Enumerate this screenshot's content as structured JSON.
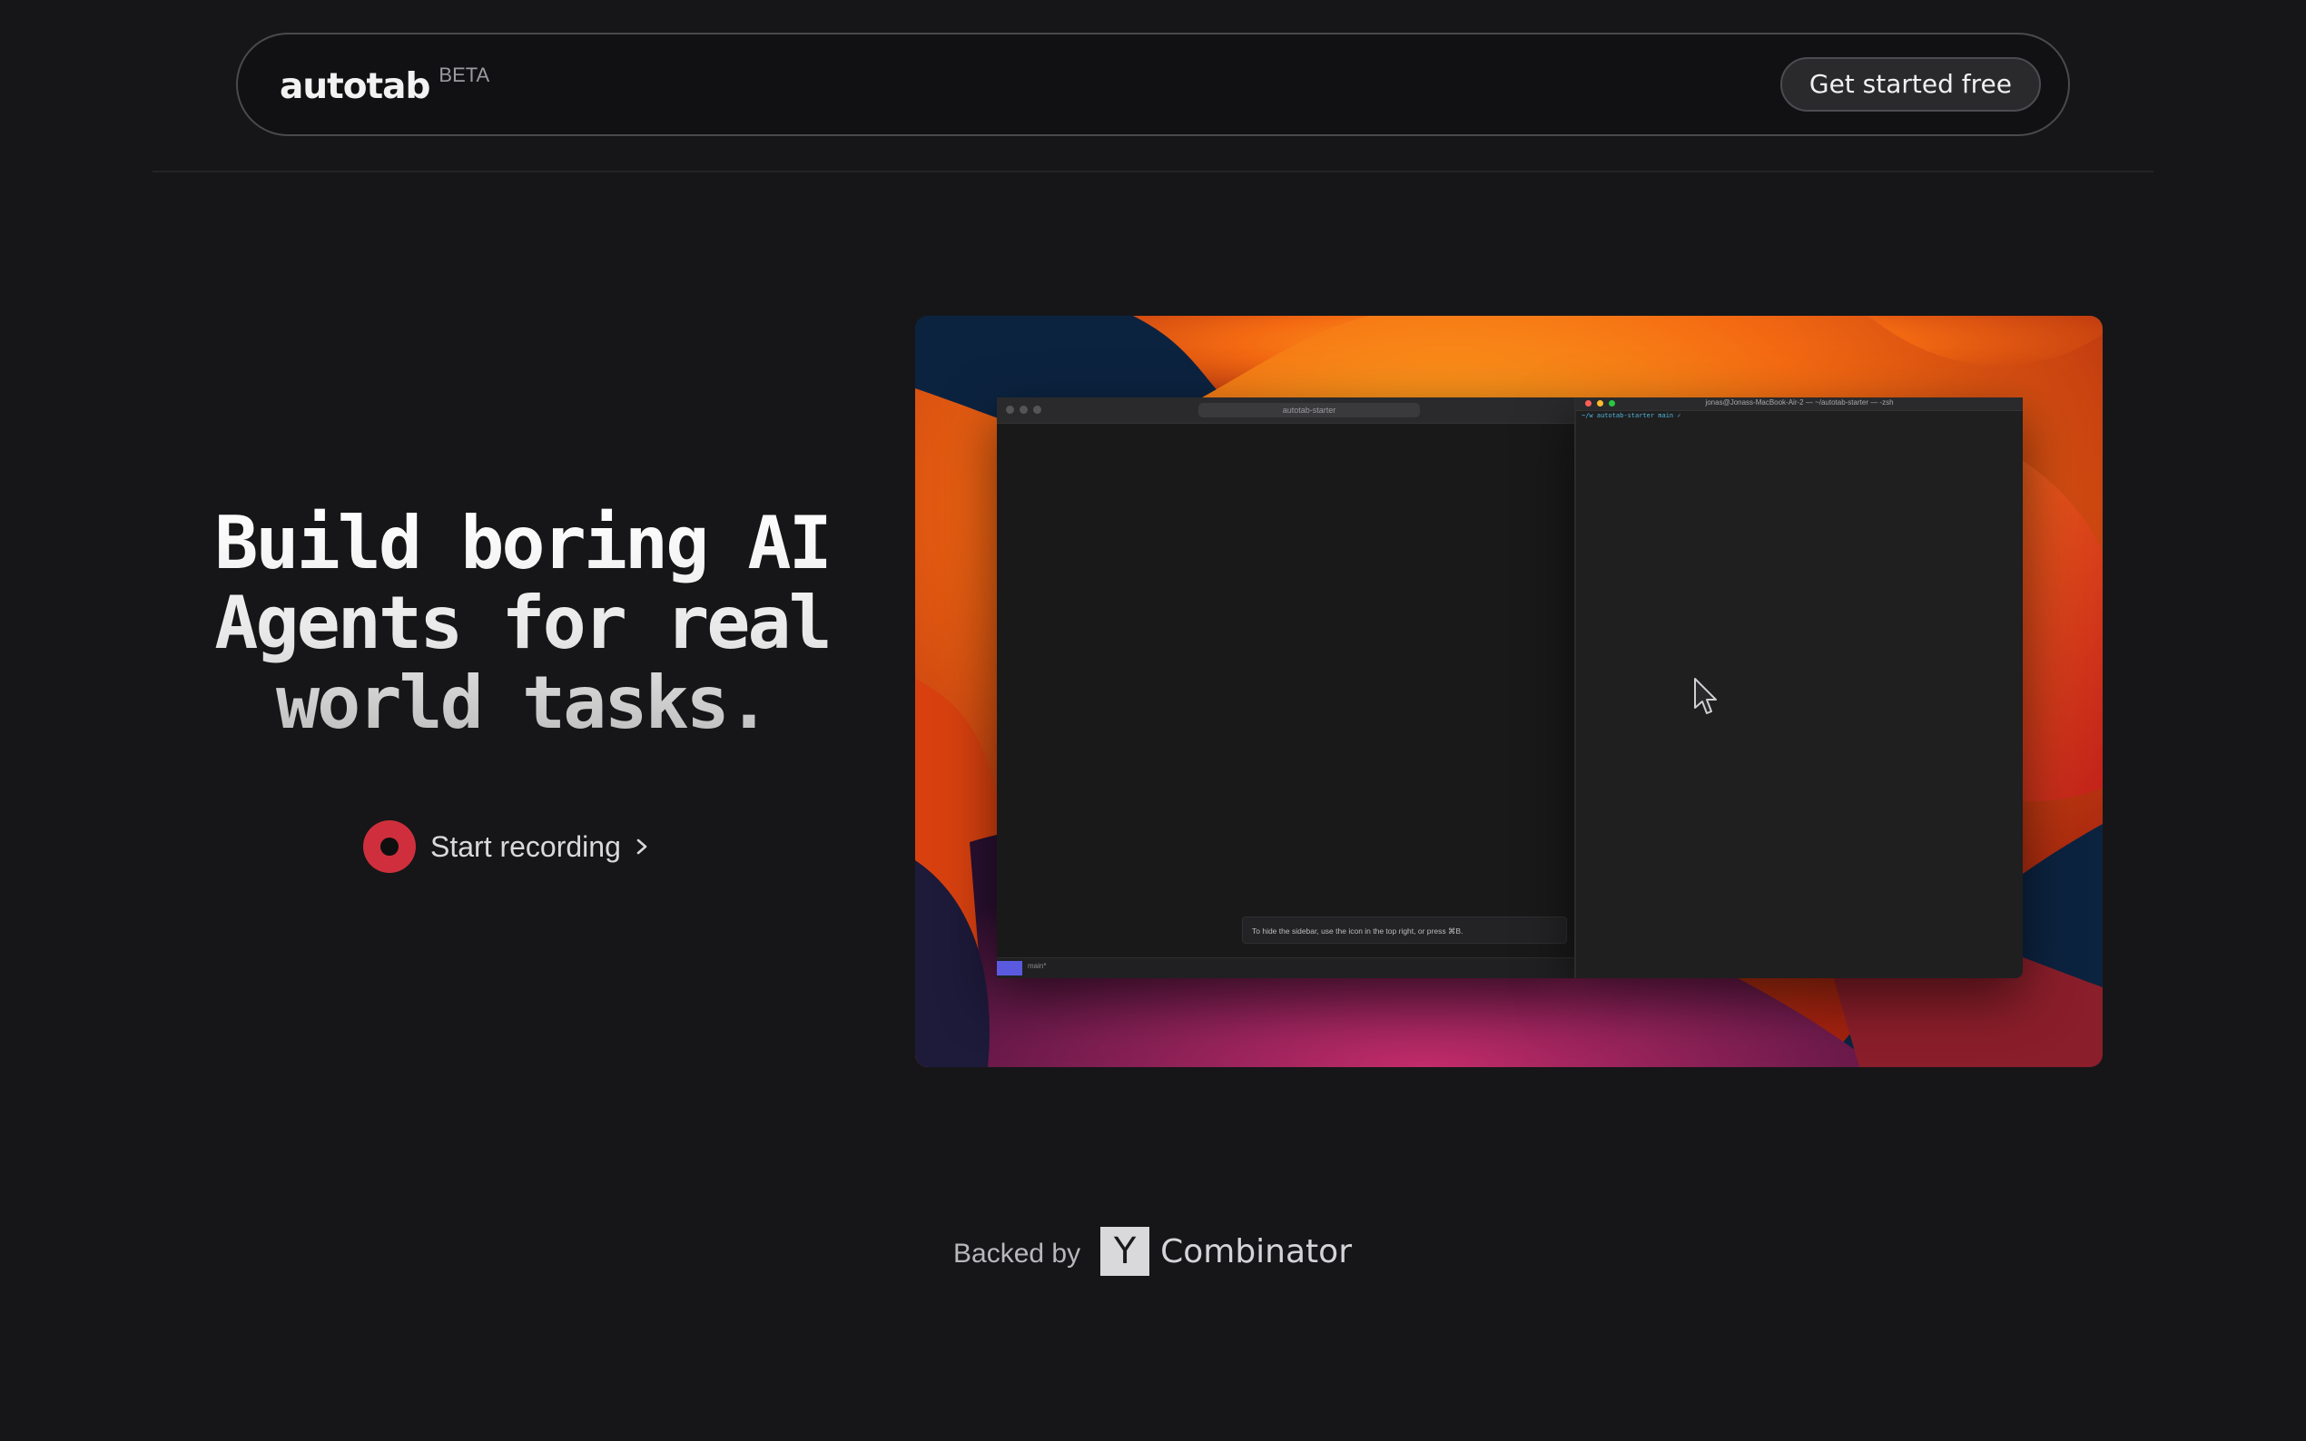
{
  "nav": {
    "brand": "autotab",
    "badge": "BETA",
    "cta_label": "Get started free"
  },
  "hero": {
    "title_lines": [
      "Build boring AI",
      "Agents for real",
      "world tasks."
    ],
    "record_label": "Start recording"
  },
  "demo": {
    "browser_url": "autotab-starter",
    "terminal_title": "jonas@Jonass-MacBook-Air-2 — ~/autotab-starter — -zsh",
    "terminal_prompt": "~/w autotab-starter  main ✓",
    "toast_text": "To hide the sidebar, use the icon in the top right, or press ⌘B.",
    "status_branch": "main*"
  },
  "backed": {
    "label": "Backed by",
    "logo_letter": "Y",
    "name": "Combinator"
  },
  "colors": {
    "background": "#161618",
    "record_red": "#cf2f3d",
    "nav_border": "#4a4a4d",
    "yc_logo_bg": "#d9d9dc"
  },
  "icons": {
    "record": "record-dot-icon",
    "chevron": "chevron-right-icon",
    "cursor": "mouse-pointer-icon"
  }
}
